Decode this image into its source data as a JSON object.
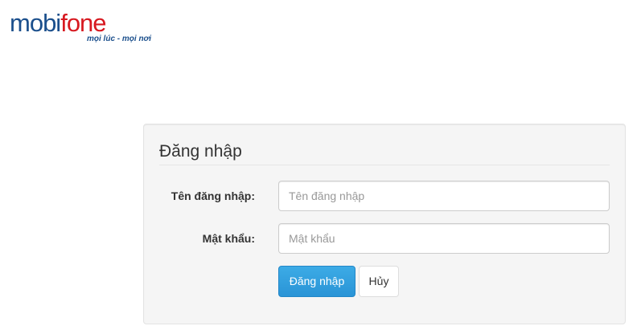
{
  "brand": {
    "logo_part1": "mobi",
    "logo_part2": "fone",
    "tagline": "mọi lúc - mọi nơi",
    "colors": {
      "blue": "#1b4f8c",
      "red": "#d71920"
    }
  },
  "login": {
    "title": "Đăng nhập",
    "username": {
      "label": "Tên đăng nhập:",
      "value": "",
      "placeholder": "Tên đăng nhập"
    },
    "password": {
      "label": "Mật khẩu:",
      "value": "",
      "placeholder": "Mật khẩu"
    },
    "submit_label": "Đăng nhập",
    "cancel_label": "Hủy",
    "colors": {
      "primary": "#2a94d6"
    }
  }
}
